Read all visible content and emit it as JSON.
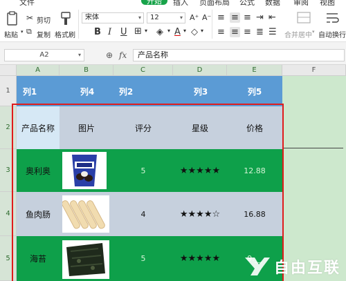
{
  "menu": {
    "items": [
      "文件",
      "开始",
      "插入",
      "页面布局",
      "公式",
      "数据",
      "审阅",
      "视图"
    ],
    "active": "开始"
  },
  "ribbon": {
    "paste": "粘贴",
    "cut": "剪切",
    "copy": "复制",
    "format_painter": "格式刷",
    "font_name": "宋体",
    "font_size": "12",
    "merge_center": "合并居中",
    "auto_wrap": "自动换行"
  },
  "formula_bar": {
    "name_box": "A2",
    "fx": "fx",
    "content": "产品名称"
  },
  "columns": [
    "A",
    "B",
    "C",
    "D",
    "E",
    "F"
  ],
  "rows": [
    "1",
    "2",
    "3",
    "4",
    "5"
  ],
  "table": {
    "header": [
      "列1",
      "列4",
      "列2",
      "列3",
      "列5"
    ],
    "col_headers": [
      "产品名称",
      "图片",
      "评分",
      "星级",
      "价格"
    ],
    "rows": [
      {
        "name": "奥利奥",
        "image": "oreo-package",
        "score": "5",
        "stars": "★★★★★",
        "price": "12.88"
      },
      {
        "name": "鱼肉肠",
        "image": "fish-sausage",
        "score": "4",
        "stars": "★★★★☆",
        "price": "16.88"
      },
      {
        "name": "海苔",
        "image": "seaweed",
        "score": "5",
        "stars": "★★★★★",
        "price": "9.__"
      }
    ]
  },
  "watermark": {
    "text": "自由互联"
  },
  "colors": {
    "header_blue": "#5b9bd5",
    "band_green": "#0ea04a",
    "band_gray": "#c6d0dd",
    "highlight_red": "#e01b1b"
  }
}
